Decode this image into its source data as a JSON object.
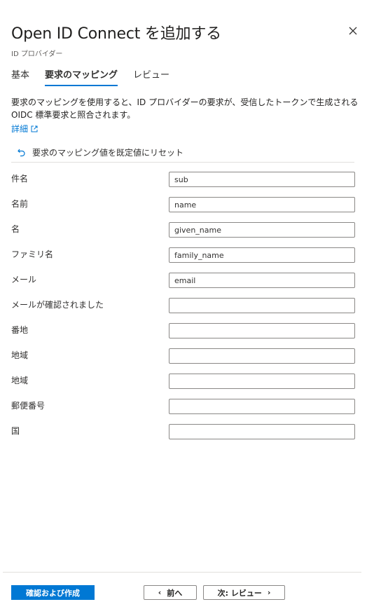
{
  "header": {
    "title": "Open ID Connect を追加する",
    "subtitle": "ID プロバイダー"
  },
  "tabs": [
    {
      "label": "基本",
      "active": false
    },
    {
      "label": "要求のマッピング",
      "active": true
    },
    {
      "label": "レビュー",
      "active": false
    }
  ],
  "description": "要求のマッピングを使用すると、ID プロバイダーの要求が、受信したトークンで生成される OIDC 標準要求と照合されます。",
  "more_link": "詳細",
  "reset_label": "要求のマッピング値を既定値にリセット",
  "fields": [
    {
      "label": "件名",
      "value": "sub"
    },
    {
      "label": "名前",
      "value": "name"
    },
    {
      "label": "名",
      "value": "given_name"
    },
    {
      "label": "ファミリ名",
      "value": "family_name"
    },
    {
      "label": "メール",
      "value": "email"
    },
    {
      "label": "メールが確認されました",
      "value": ""
    },
    {
      "label": "番地",
      "value": ""
    },
    {
      "label": "地域",
      "value": ""
    },
    {
      "label": "地域",
      "value": ""
    },
    {
      "label": "郵便番号",
      "value": ""
    },
    {
      "label": "国",
      "value": ""
    }
  ],
  "footer": {
    "review_create_label": "確認および作成",
    "prev_label": "前へ",
    "next_label": "次: レビュー"
  },
  "colors": {
    "accent": "#0078d4",
    "text": "#201f1e",
    "border": "#8a8886"
  }
}
